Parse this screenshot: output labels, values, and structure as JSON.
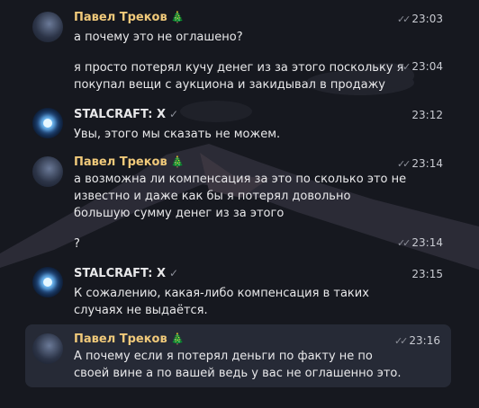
{
  "messages": [
    {
      "author": "Павел Треков",
      "time": "23:03",
      "text": "а почему это не оглашено?",
      "read": true
    },
    {
      "time": "23:04",
      "text": "я просто потерял кучу денег из за этого поскольку я покупал вещи с аукциона и закидывал в продажу",
      "read": true
    },
    {
      "author": "STALCRAFT: X",
      "time": "23:12",
      "text": "Увы, этого мы сказать не можем."
    },
    {
      "author": "Павел Треков",
      "time": "23:14",
      "text": "а возможна ли компенсация за это по сколько это не известно и даже как бы  я потерял довольно большую сумму денег из за этого",
      "read": true
    },
    {
      "time": "23:14",
      "text": "?",
      "read": true
    },
    {
      "author": "STALCRAFT: X",
      "time": "23:15",
      "text": "К сожалению, какая-либо компенсация в таких случаях не выдаётся."
    },
    {
      "author": "Павел Треков",
      "time": "23:16",
      "text": "А почему если я потерял деньги по факту не по своей вине а по вашей ведь у вас не оглашенно это.",
      "read": true
    }
  ],
  "icons": {
    "tree": "🎄",
    "verified": "✓",
    "read_checks": "✓✓"
  },
  "colors": {
    "background": "#16181f",
    "highlight": "#262a36",
    "pavel_name": "#f0c97a"
  }
}
